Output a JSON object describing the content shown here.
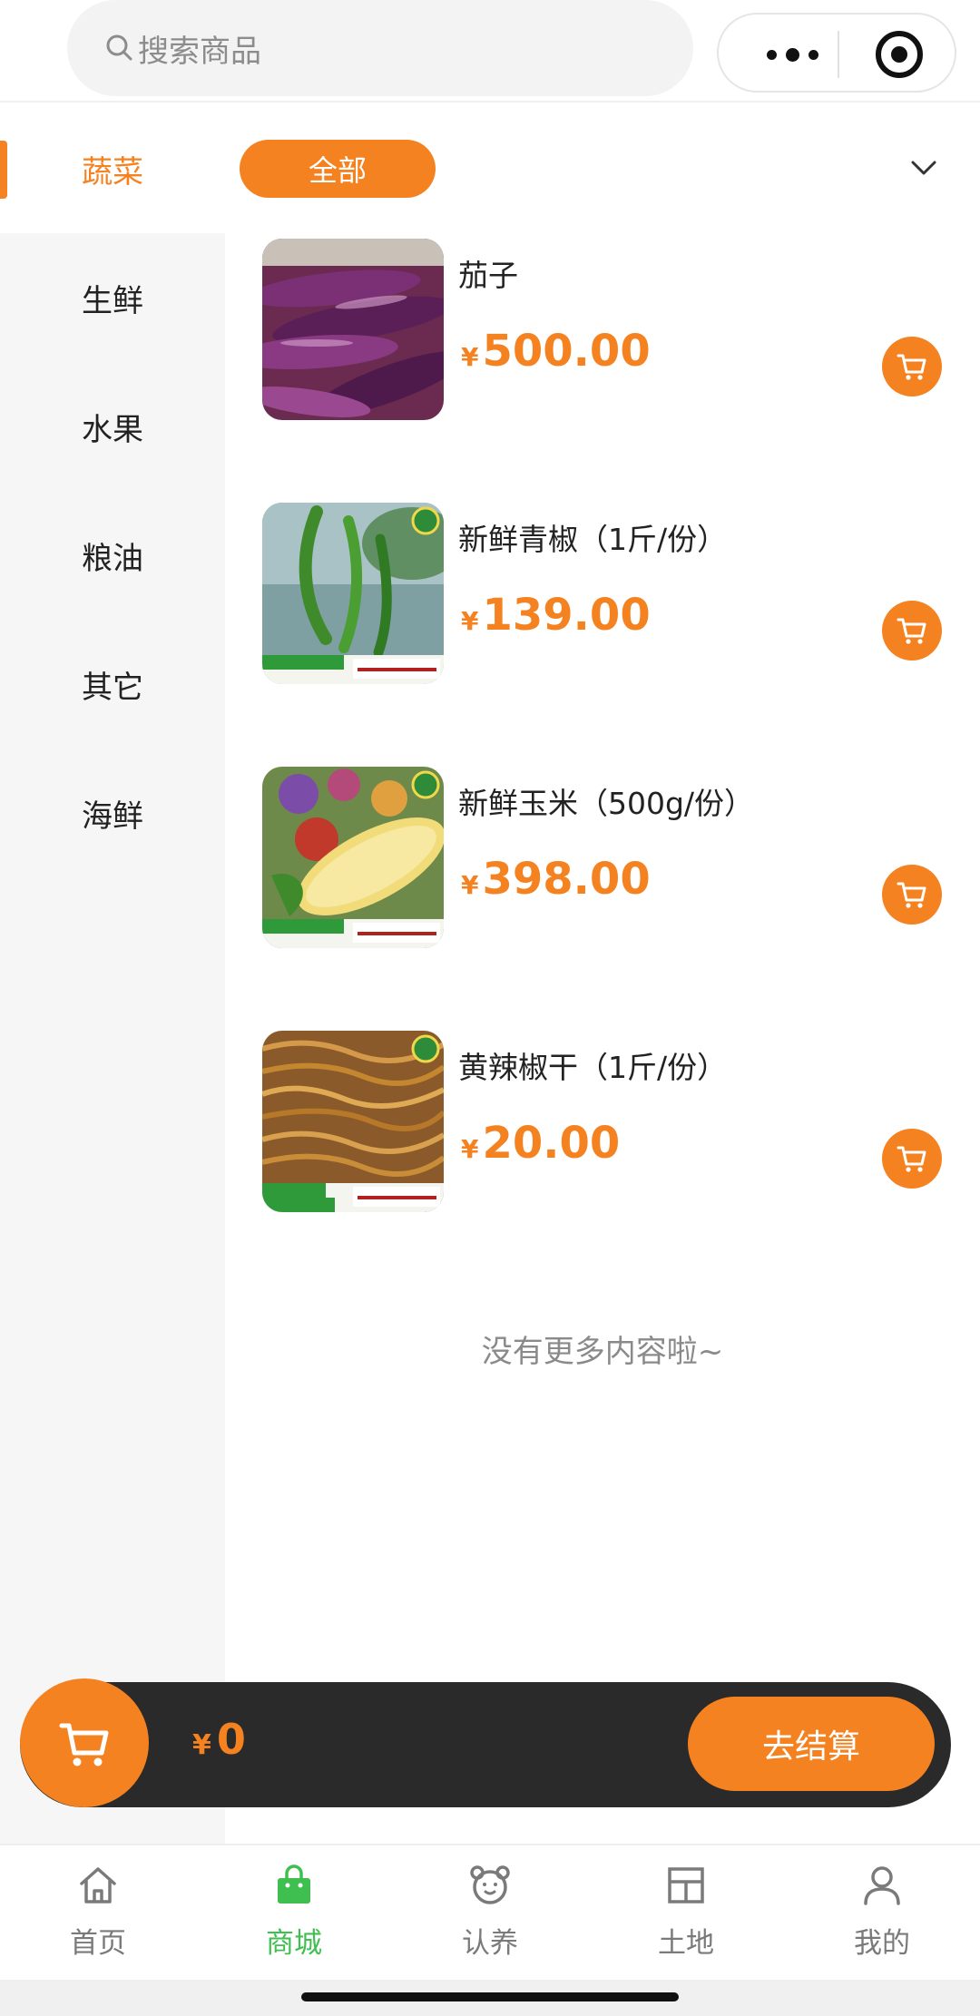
{
  "search": {
    "placeholder": "搜索商品"
  },
  "sidebar": {
    "items": [
      {
        "label": "蔬菜",
        "active": true
      },
      {
        "label": "生鲜"
      },
      {
        "label": "水果"
      },
      {
        "label": "粮油"
      },
      {
        "label": "其它"
      },
      {
        "label": "海鲜"
      }
    ]
  },
  "filter": {
    "chip_label": "全部"
  },
  "products": [
    {
      "name": "茄子",
      "currency": "¥",
      "price": "500.00",
      "image": "eggplant"
    },
    {
      "name": "新鲜青椒（1斤/份）",
      "currency": "¥",
      "price": "139.00",
      "image": "green-pepper"
    },
    {
      "name": "新鲜玉米（500g/份）",
      "currency": "¥",
      "price": "398.00",
      "image": "corn"
    },
    {
      "name": "黄辣椒干（1斤/份）",
      "currency": "¥",
      "price": "20.00",
      "image": "dried-yellow-chili"
    }
  ],
  "list_footer": "没有更多内容啦~",
  "cart": {
    "currency": "¥",
    "total": "0",
    "checkout_label": "去结算"
  },
  "tabbar": {
    "tabs": [
      {
        "label": "首页",
        "icon": "home-icon"
      },
      {
        "label": "商城",
        "icon": "shop-bag-icon",
        "active": true
      },
      {
        "label": "认养",
        "icon": "bear-icon"
      },
      {
        "label": "土地",
        "icon": "grid-icon"
      },
      {
        "label": "我的",
        "icon": "user-icon"
      }
    ]
  },
  "colors": {
    "accent": "#f58220",
    "active_tab": "#3fbf4f",
    "cart_bar": "#2a2a2a"
  }
}
